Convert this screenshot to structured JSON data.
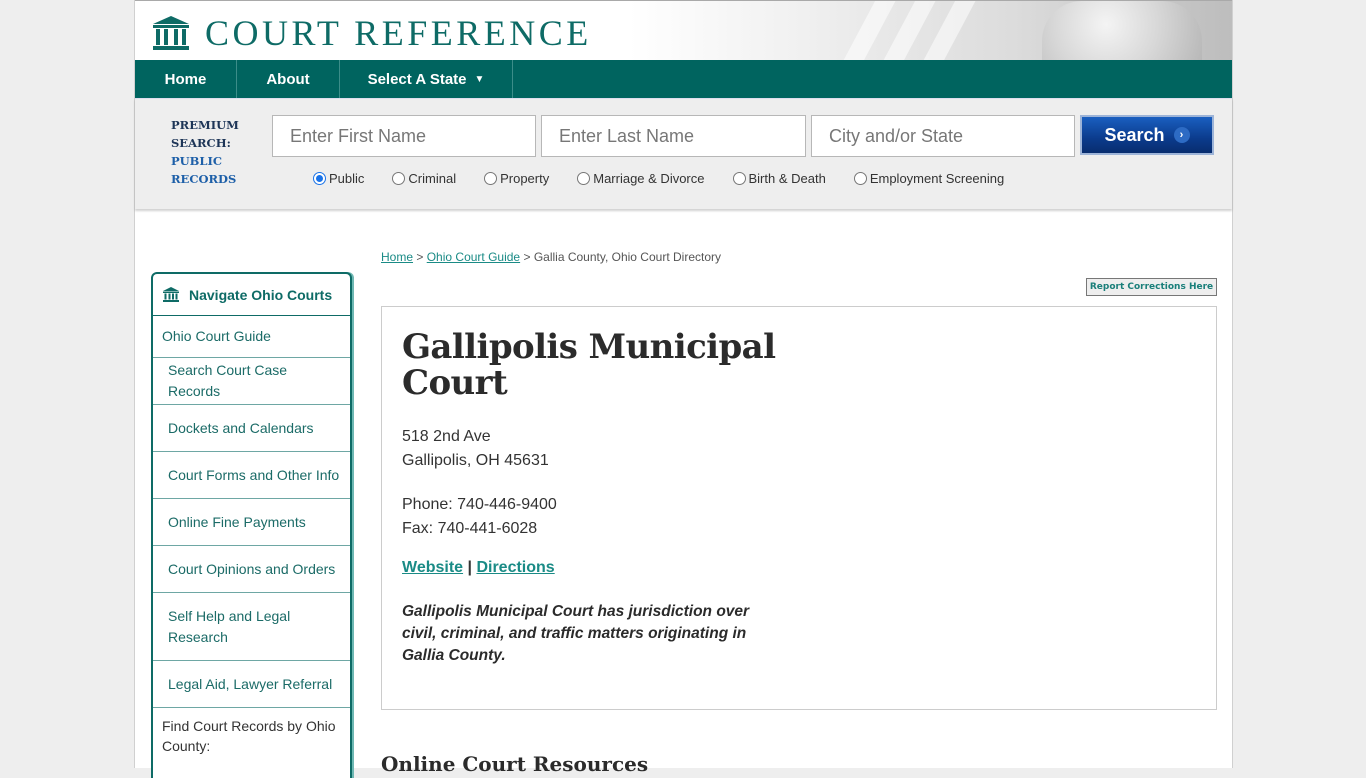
{
  "brand": {
    "name": "COURT REFERENCE",
    "accent": "#00645f",
    "link_color": "#1a8b86"
  },
  "nav": {
    "home": "Home",
    "about": "About",
    "select_state": "Select A State",
    "caret": "▼"
  },
  "search": {
    "premium_line1": "PREMIUM",
    "premium_line2": "SEARCH:",
    "premium_line3": "PUBLIC",
    "premium_line4": "RECORDS",
    "first_name_placeholder": "Enter First Name",
    "last_name_placeholder": "Enter Last Name",
    "city_state_placeholder": "City and/or State",
    "button_label": "Search",
    "button_icon": "›",
    "record_types": [
      {
        "label": "Public",
        "selected": true
      },
      {
        "label": "Criminal",
        "selected": false
      },
      {
        "label": "Property",
        "selected": false
      },
      {
        "label": "Marriage & Divorce",
        "selected": false
      },
      {
        "label": "Birth & Death",
        "selected": false
      },
      {
        "label": "Employment Screening",
        "selected": false
      }
    ]
  },
  "breadcrumb": {
    "home": "Home",
    "sep": ">",
    "guide": "Ohio Court Guide",
    "current": "Gallia County, Ohio Court Directory"
  },
  "report_button": "Report Corrections Here",
  "sidebar": {
    "title": "Navigate Ohio Courts",
    "items": [
      "Ohio Court Guide",
      "Search Court Case Records",
      "Dockets and Calendars",
      "Court Forms and Other Info",
      "Online Fine Payments",
      "Court Opinions and Orders",
      "Self Help and Legal Research",
      "Legal Aid, Lawyer Referral"
    ],
    "county_label": "Find Court Records by Ohio County:"
  },
  "court": {
    "name": "Gallipolis Municipal Court",
    "address_line1": "518 2nd Ave",
    "address_line2": "Gallipolis, OH 45631",
    "phone": "Phone: 740-446-9400",
    "fax": "Fax: 740-441-6028",
    "website_label": "Website",
    "link_sep": "|",
    "directions_label": "Directions",
    "description": "Gallipolis Municipal Court has jurisdiction over civil, criminal, and traffic matters originating in Gallia County."
  },
  "section_heading": "Online Court Resources"
}
